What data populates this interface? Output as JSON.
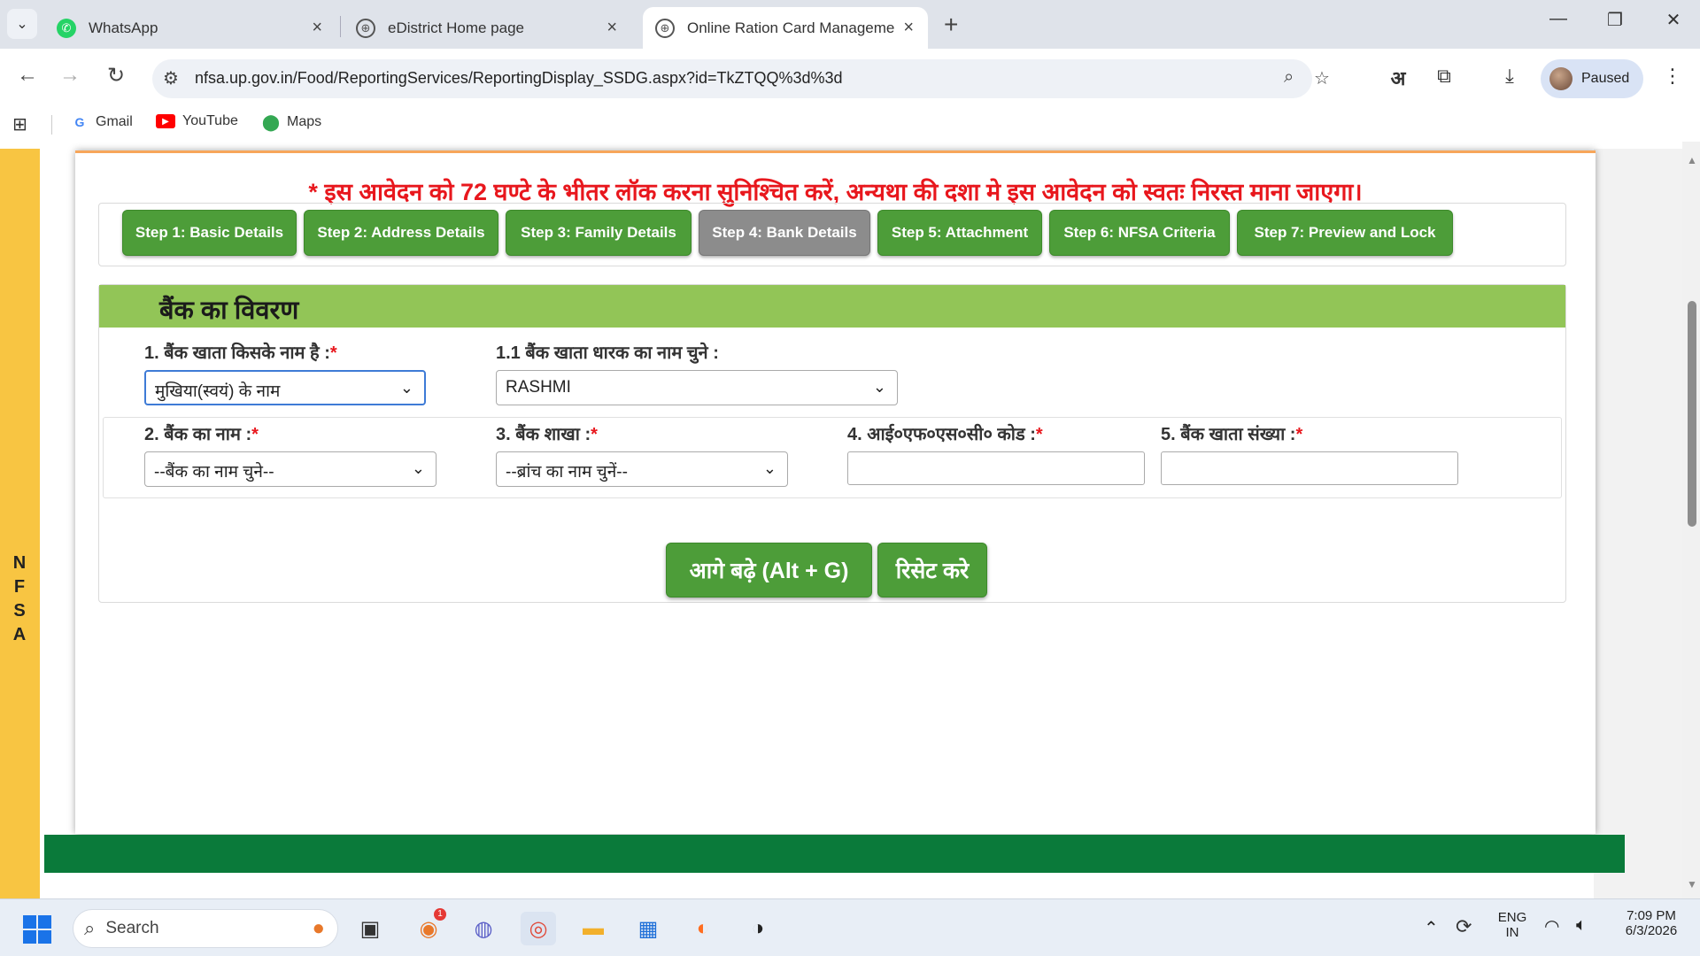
{
  "browser": {
    "tabs": [
      {
        "title": "WhatsApp",
        "icon": "whatsapp-icon"
      },
      {
        "title": "eDistrict Home page",
        "icon": "globe-icon"
      },
      {
        "title": "Online Ration Card Manageme",
        "icon": "globe-icon",
        "active": true
      }
    ],
    "url": "nfsa.up.gov.in/Food/ReportingServices/ReportingDisplay_SSDG.aspx?id=TkZTQQ%3d%3d",
    "translate_glyph": "अ",
    "profile_label": "Paused",
    "bookmarks": [
      {
        "label": "Gmail",
        "icon": "google-icon"
      },
      {
        "label": "YouTube",
        "icon": "youtube-icon"
      },
      {
        "label": "Maps",
        "icon": "maps-icon"
      }
    ]
  },
  "page": {
    "side_label": [
      "N",
      "F",
      "S",
      "A"
    ],
    "notice": "* इस आवेदन को 72 घण्टे के भीतर लॉक करना सुनिश्चित करें, अन्यथा की दशा मे इस आवेदन को स्वतः निरस्त माना जाएगा।",
    "steps": [
      "Step 1: Basic Details",
      "Step 2: Address Details",
      "Step 3: Family Details",
      "Step 4: Bank Details",
      "Step 5: Attachment",
      "Step 6: NFSA Criteria",
      "Step 7: Preview and Lock"
    ],
    "current_step": 4,
    "section_title": "बैंक का विवरण",
    "fields": {
      "account_owner": {
        "label": "1. बैंक खाता किसके नाम है :",
        "required": "*",
        "value": "मुखिया(स्वयं) के नाम"
      },
      "holder_name": {
        "label": "1.1 बैंक खाता धारक का नाम चुने :",
        "value": "RASHMI"
      },
      "bank_name": {
        "label": "2. बैंक का नाम :",
        "required": "*",
        "value": "--बैंक का नाम चुने--"
      },
      "branch": {
        "label": "3. बैंक शाखा :",
        "required": "*",
        "value": "--ब्रांच का नाम चुनें--"
      },
      "ifsc": {
        "label": "4. आई०एफ०एस०सी० कोड :",
        "required": "*",
        "value": ""
      },
      "account_number": {
        "label": "5. बैंक खाता संख्या :",
        "required": "*",
        "value": ""
      }
    },
    "buttons": {
      "next": "आगे बढ़े (Alt + G)",
      "reset": "रिसेट करे"
    }
  },
  "taskbar": {
    "search_placeholder": "Search",
    "notification_count": "1",
    "language": "ENG",
    "region": "IN",
    "time": "7:09 PM",
    "date": "6/3/2026"
  },
  "colors": {
    "step_green": "#4d9d39",
    "step_current": "#8c8c8c",
    "section_header": "#92c557",
    "notice_red": "#e8171d",
    "side_bar": "#f8c542",
    "footer": "#0a7a3a"
  }
}
